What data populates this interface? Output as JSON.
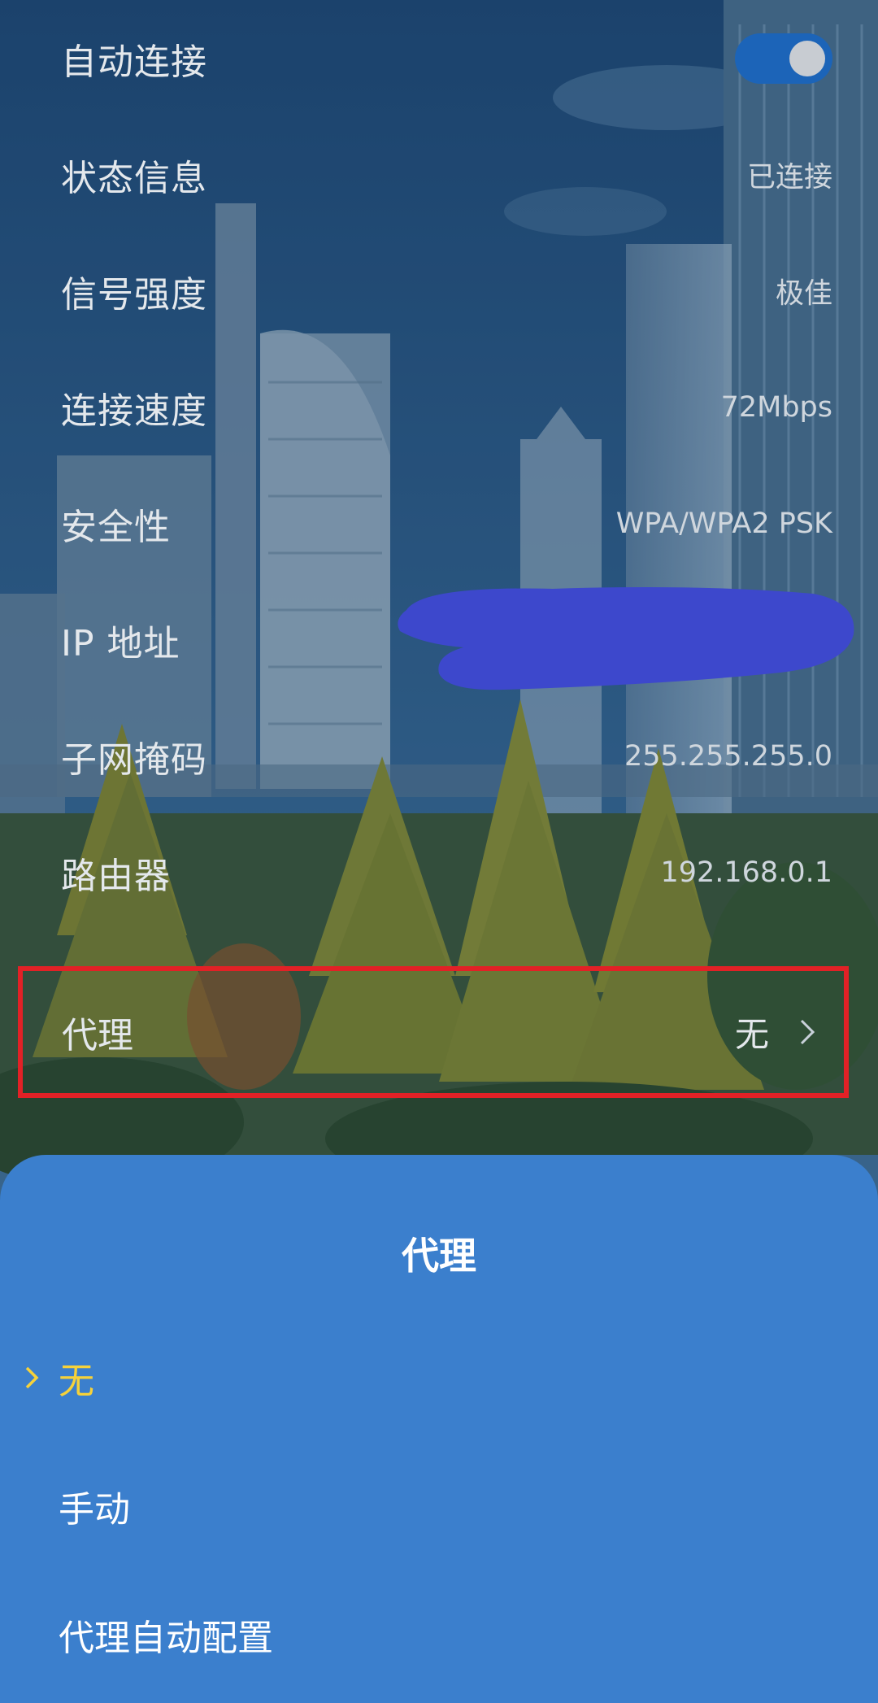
{
  "settings": {
    "auto_connect": {
      "label": "自动连接",
      "enabled": true
    },
    "status": {
      "label": "状态信息",
      "value": "已连接"
    },
    "signal": {
      "label": "信号强度",
      "value": "极佳"
    },
    "speed": {
      "label": "连接速度",
      "value": "72Mbps"
    },
    "security": {
      "label": "安全性",
      "value": "WPA/WPA2 PSK"
    },
    "ip": {
      "label": "IP 地址"
    },
    "subnet": {
      "label": "子网掩码",
      "value": "255.255.255.0"
    },
    "router": {
      "label": "路由器",
      "value": "192.168.0.1"
    },
    "proxy": {
      "label": "代理",
      "value": "无"
    }
  },
  "sheet": {
    "title": "代理",
    "options": [
      {
        "label": "无",
        "selected": true
      },
      {
        "label": "手动",
        "selected": false
      },
      {
        "label": "代理自动配置",
        "selected": false
      }
    ]
  },
  "colors": {
    "toggle_on": "#1c64b8",
    "highlight_border": "#e22126",
    "sheet_bg": "#3b7fcd",
    "selected_option": "#f6d23a",
    "redaction": "#3d48cc"
  }
}
